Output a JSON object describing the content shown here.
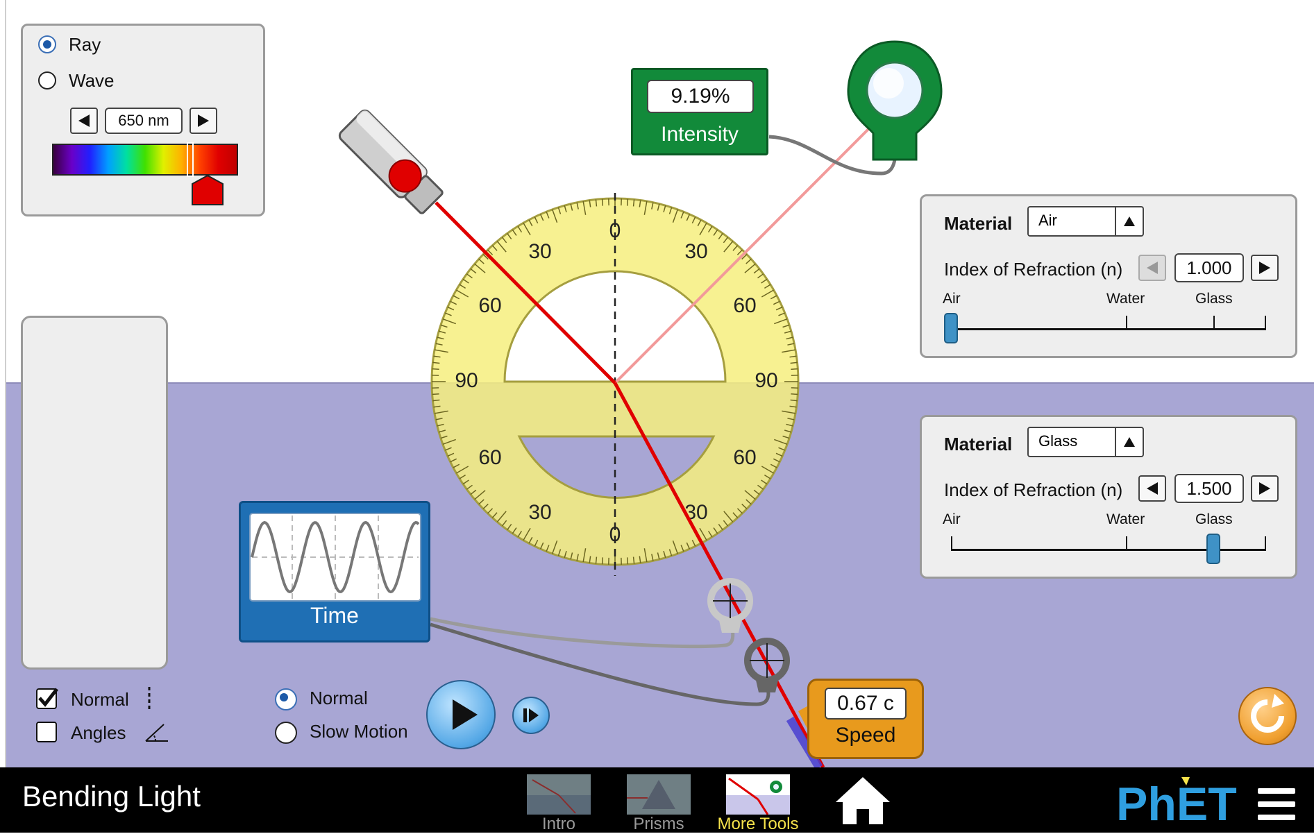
{
  "app": {
    "title": "Bending Light",
    "brand": "PhET"
  },
  "light_panel": {
    "modes": [
      {
        "label": "Ray",
        "selected": true
      },
      {
        "label": "Wave",
        "selected": false
      }
    ],
    "wavelength": "650 nm"
  },
  "intensity_meter": {
    "value": "9.19%",
    "label": "Intensity"
  },
  "protractor": {
    "ticks": [
      "0",
      "30",
      "60",
      "90",
      "60",
      "30",
      "0",
      "30",
      "60",
      "90",
      "60",
      "30"
    ]
  },
  "top_medium": {
    "material_label": "Material",
    "material": "Air",
    "index_label": "Index of Refraction (n)",
    "index": "1.000",
    "slider_labels": [
      "Air",
      "Water",
      "Glass"
    ],
    "slider_value": 1.0
  },
  "bottom_medium": {
    "material_label": "Material",
    "material": "Glass",
    "index_label": "Index of Refraction (n)",
    "index": "1.500",
    "slider_labels": [
      "Air",
      "Water",
      "Glass"
    ],
    "slider_value": 1.5
  },
  "time_tool": {
    "label": "Time"
  },
  "speed_tool": {
    "value": "0.67 c",
    "label": "Speed"
  },
  "view_options": [
    {
      "label": "Normal",
      "checked": true
    },
    {
      "label": "Angles",
      "checked": false
    }
  ],
  "time_speed": [
    {
      "label": "Normal",
      "selected": true
    },
    {
      "label": "Slow Motion",
      "selected": false
    }
  ],
  "nav": {
    "screens": [
      {
        "label": "Intro",
        "active": false
      },
      {
        "label": "Prisms",
        "active": false
      },
      {
        "label": "More Tools",
        "active": true
      }
    ]
  },
  "colors": {
    "bottom_medium": "#a8a6d4",
    "laser": "#e00000",
    "intensity_green": "#128a3a",
    "speed_orange": "#e89a1d",
    "time_blue": "#1f6fb4",
    "protractor_yellow": "#f6ef7e",
    "active_nav": "#f6e34b"
  }
}
